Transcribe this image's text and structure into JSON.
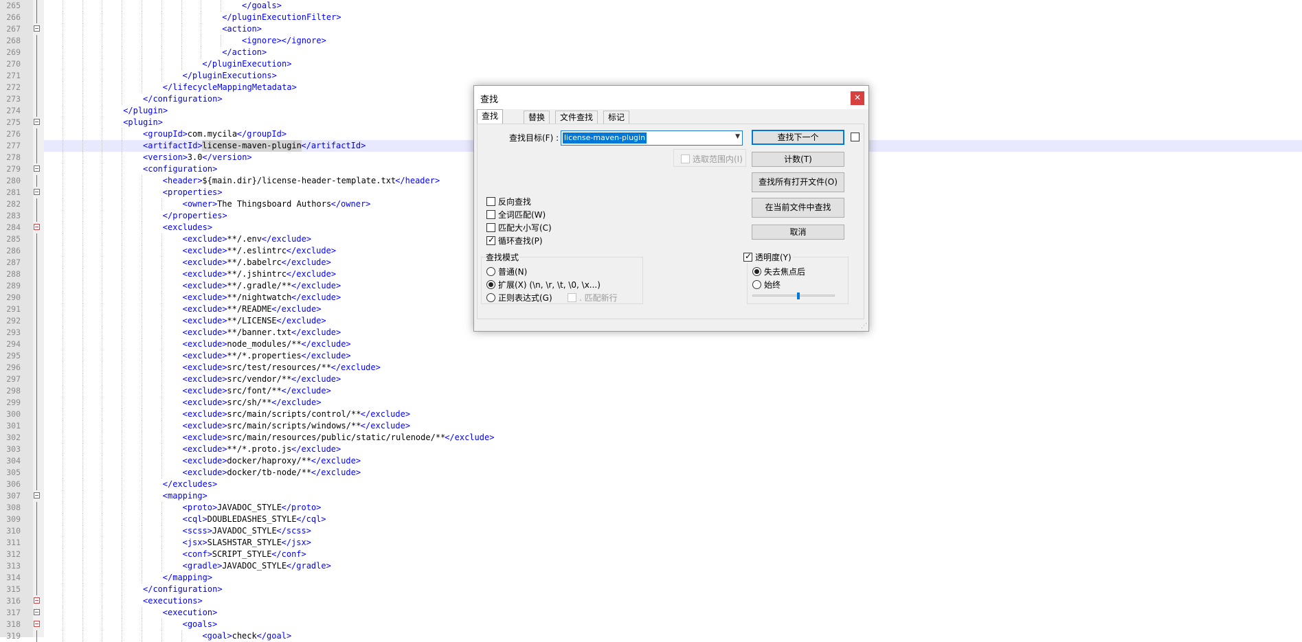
{
  "editor": {
    "first_line": 265,
    "current_line": 277,
    "lines": [
      {
        "n": "265",
        "level": 10,
        "parts": [
          {
            "t": "</goals>",
            "c": "tag"
          }
        ]
      },
      {
        "n": "266",
        "level": 9,
        "parts": [
          {
            "t": "</pluginExecutionFilter>",
            "c": "tag"
          }
        ]
      },
      {
        "n": "267",
        "level": 9,
        "fold": true,
        "parts": [
          {
            "t": "<action>",
            "c": "tag"
          }
        ]
      },
      {
        "n": "268",
        "level": 10,
        "parts": [
          {
            "t": "<ignore></ignore>",
            "c": "tag"
          }
        ]
      },
      {
        "n": "269",
        "level": 9,
        "parts": [
          {
            "t": "</action>",
            "c": "tag"
          }
        ]
      },
      {
        "n": "270",
        "level": 8,
        "parts": [
          {
            "t": "</pluginExecution>",
            "c": "tag"
          }
        ]
      },
      {
        "n": "271",
        "level": 7,
        "parts": [
          {
            "t": "</pluginExecutions>",
            "c": "tag"
          }
        ]
      },
      {
        "n": "272",
        "level": 6,
        "parts": [
          {
            "t": "</lifecycleMappingMetadata>",
            "c": "tag"
          }
        ]
      },
      {
        "n": "273",
        "level": 5,
        "parts": [
          {
            "t": "</configuration>",
            "c": "tag"
          }
        ]
      },
      {
        "n": "274",
        "level": 4,
        "parts": [
          {
            "t": "</plugin>",
            "c": "tag"
          }
        ]
      },
      {
        "n": "275",
        "level": 4,
        "fold": true,
        "parts": [
          {
            "t": "<plugin>",
            "c": "tag"
          }
        ]
      },
      {
        "n": "276",
        "level": 5,
        "parts": [
          {
            "t": "<groupId>",
            "c": "tag"
          },
          {
            "t": "com.mycila",
            "c": "text"
          },
          {
            "t": "</groupId>",
            "c": "tag"
          }
        ]
      },
      {
        "n": "277",
        "level": 5,
        "parts": [
          {
            "t": "<artifactId>",
            "c": "tag"
          },
          {
            "t": "license-maven-plugin",
            "c": "text",
            "hl": true
          },
          {
            "t": "</artifactId>",
            "c": "tag"
          }
        ]
      },
      {
        "n": "278",
        "level": 5,
        "parts": [
          {
            "t": "<version>",
            "c": "tag"
          },
          {
            "t": "3.0",
            "c": "text"
          },
          {
            "t": "</version>",
            "c": "tag"
          }
        ]
      },
      {
        "n": "279",
        "level": 5,
        "fold": true,
        "parts": [
          {
            "t": "<configuration>",
            "c": "tag"
          }
        ]
      },
      {
        "n": "280",
        "level": 6,
        "parts": [
          {
            "t": "<header>",
            "c": "tag"
          },
          {
            "t": "${main.dir}/license-header-template.txt",
            "c": "text"
          },
          {
            "t": "</header>",
            "c": "tag"
          }
        ]
      },
      {
        "n": "281",
        "level": 6,
        "fold": true,
        "parts": [
          {
            "t": "<properties>",
            "c": "tag"
          }
        ]
      },
      {
        "n": "282",
        "level": 7,
        "parts": [
          {
            "t": "<owner>",
            "c": "tag"
          },
          {
            "t": "The Thingsboard Authors",
            "c": "text"
          },
          {
            "t": "</owner>",
            "c": "tag"
          }
        ]
      },
      {
        "n": "283",
        "level": 6,
        "parts": [
          {
            "t": "</properties>",
            "c": "tag"
          }
        ]
      },
      {
        "n": "284",
        "level": 6,
        "fold": true,
        "parts": [
          {
            "t": "<excludes>",
            "c": "tag"
          }
        ]
      },
      {
        "n": "285",
        "level": 7,
        "parts": [
          {
            "t": "<exclude>",
            "c": "tag"
          },
          {
            "t": "**/.env",
            "c": "text"
          },
          {
            "t": "</exclude>",
            "c": "tag"
          }
        ]
      },
      {
        "n": "286",
        "level": 7,
        "parts": [
          {
            "t": "<exclude>",
            "c": "tag"
          },
          {
            "t": "**/.eslintrc",
            "c": "text"
          },
          {
            "t": "</exclude>",
            "c": "tag"
          }
        ]
      },
      {
        "n": "287",
        "level": 7,
        "parts": [
          {
            "t": "<exclude>",
            "c": "tag"
          },
          {
            "t": "**/.babelrc",
            "c": "text"
          },
          {
            "t": "</exclude>",
            "c": "tag"
          }
        ]
      },
      {
        "n": "288",
        "level": 7,
        "parts": [
          {
            "t": "<exclude>",
            "c": "tag"
          },
          {
            "t": "**/.jshintrc",
            "c": "text"
          },
          {
            "t": "</exclude>",
            "c": "tag"
          }
        ]
      },
      {
        "n": "289",
        "level": 7,
        "parts": [
          {
            "t": "<exclude>",
            "c": "tag"
          },
          {
            "t": "**/.gradle/**",
            "c": "text"
          },
          {
            "t": "</exclude>",
            "c": "tag"
          }
        ]
      },
      {
        "n": "290",
        "level": 7,
        "parts": [
          {
            "t": "<exclude>",
            "c": "tag"
          },
          {
            "t": "**/nightwatch",
            "c": "text"
          },
          {
            "t": "</exclude>",
            "c": "tag"
          }
        ]
      },
      {
        "n": "291",
        "level": 7,
        "parts": [
          {
            "t": "<exclude>",
            "c": "tag"
          },
          {
            "t": "**/README",
            "c": "text"
          },
          {
            "t": "</exclude>",
            "c": "tag"
          }
        ]
      },
      {
        "n": "292",
        "level": 7,
        "parts": [
          {
            "t": "<exclude>",
            "c": "tag"
          },
          {
            "t": "**/LICENSE",
            "c": "text"
          },
          {
            "t": "</exclude>",
            "c": "tag"
          }
        ]
      },
      {
        "n": "293",
        "level": 7,
        "parts": [
          {
            "t": "<exclude>",
            "c": "tag"
          },
          {
            "t": "**/banner.txt",
            "c": "text"
          },
          {
            "t": "</exclude>",
            "c": "tag"
          }
        ]
      },
      {
        "n": "294",
        "level": 7,
        "parts": [
          {
            "t": "<exclude>",
            "c": "tag"
          },
          {
            "t": "node_modules/**",
            "c": "text"
          },
          {
            "t": "</exclude>",
            "c": "tag"
          }
        ]
      },
      {
        "n": "295",
        "level": 7,
        "parts": [
          {
            "t": "<exclude>",
            "c": "tag"
          },
          {
            "t": "**/*.properties",
            "c": "text"
          },
          {
            "t": "</exclude>",
            "c": "tag"
          }
        ]
      },
      {
        "n": "296",
        "level": 7,
        "parts": [
          {
            "t": "<exclude>",
            "c": "tag"
          },
          {
            "t": "src/test/resources/**",
            "c": "text"
          },
          {
            "t": "</exclude>",
            "c": "tag"
          }
        ]
      },
      {
        "n": "297",
        "level": 7,
        "parts": [
          {
            "t": "<exclude>",
            "c": "tag"
          },
          {
            "t": "src/vendor/**",
            "c": "text"
          },
          {
            "t": "</exclude>",
            "c": "tag"
          }
        ]
      },
      {
        "n": "298",
        "level": 7,
        "parts": [
          {
            "t": "<exclude>",
            "c": "tag"
          },
          {
            "t": "src/font/**",
            "c": "text"
          },
          {
            "t": "</exclude>",
            "c": "tag"
          }
        ]
      },
      {
        "n": "299",
        "level": 7,
        "parts": [
          {
            "t": "<exclude>",
            "c": "tag"
          },
          {
            "t": "src/sh/**",
            "c": "text"
          },
          {
            "t": "</exclude>",
            "c": "tag"
          }
        ]
      },
      {
        "n": "300",
        "level": 7,
        "parts": [
          {
            "t": "<exclude>",
            "c": "tag"
          },
          {
            "t": "src/main/scripts/control/**",
            "c": "text"
          },
          {
            "t": "</exclude>",
            "c": "tag"
          }
        ]
      },
      {
        "n": "301",
        "level": 7,
        "parts": [
          {
            "t": "<exclude>",
            "c": "tag"
          },
          {
            "t": "src/main/scripts/windows/**",
            "c": "text"
          },
          {
            "t": "</exclude>",
            "c": "tag"
          }
        ]
      },
      {
        "n": "302",
        "level": 7,
        "parts": [
          {
            "t": "<exclude>",
            "c": "tag"
          },
          {
            "t": "src/main/resources/public/static/rulenode/**",
            "c": "text"
          },
          {
            "t": "</exclude>",
            "c": "tag"
          }
        ]
      },
      {
        "n": "303",
        "level": 7,
        "parts": [
          {
            "t": "<exclude>",
            "c": "tag"
          },
          {
            "t": "**/*.proto.js",
            "c": "text"
          },
          {
            "t": "</exclude>",
            "c": "tag"
          }
        ]
      },
      {
        "n": "304",
        "level": 7,
        "parts": [
          {
            "t": "<exclude>",
            "c": "tag"
          },
          {
            "t": "docker/haproxy/**",
            "c": "text"
          },
          {
            "t": "</exclude>",
            "c": "tag"
          }
        ]
      },
      {
        "n": "305",
        "level": 7,
        "parts": [
          {
            "t": "<exclude>",
            "c": "tag"
          },
          {
            "t": "docker/tb-node/**",
            "c": "text"
          },
          {
            "t": "</exclude>",
            "c": "tag"
          }
        ]
      },
      {
        "n": "306",
        "level": 6,
        "parts": [
          {
            "t": "</excludes>",
            "c": "tag"
          }
        ]
      },
      {
        "n": "307",
        "level": 6,
        "fold": true,
        "parts": [
          {
            "t": "<mapping>",
            "c": "tag"
          }
        ]
      },
      {
        "n": "308",
        "level": 7,
        "parts": [
          {
            "t": "<proto>",
            "c": "tag"
          },
          {
            "t": "JAVADOC_STYLE",
            "c": "text"
          },
          {
            "t": "</proto>",
            "c": "tag"
          }
        ]
      },
      {
        "n": "309",
        "level": 7,
        "parts": [
          {
            "t": "<cql>",
            "c": "tag"
          },
          {
            "t": "DOUBLEDASHES_STYLE",
            "c": "text"
          },
          {
            "t": "</cql>",
            "c": "tag"
          }
        ]
      },
      {
        "n": "310",
        "level": 7,
        "parts": [
          {
            "t": "<scss>",
            "c": "tag"
          },
          {
            "t": "JAVADOC_STYLE",
            "c": "text"
          },
          {
            "t": "</scss>",
            "c": "tag"
          }
        ]
      },
      {
        "n": "311",
        "level": 7,
        "parts": [
          {
            "t": "<jsx>",
            "c": "tag"
          },
          {
            "t": "SLASHSTAR_STYLE",
            "c": "text"
          },
          {
            "t": "</jsx>",
            "c": "tag"
          }
        ]
      },
      {
        "n": "312",
        "level": 7,
        "parts": [
          {
            "t": "<conf>",
            "c": "tag"
          },
          {
            "t": "SCRIPT_STYLE",
            "c": "text"
          },
          {
            "t": "</conf>",
            "c": "tag"
          }
        ]
      },
      {
        "n": "313",
        "level": 7,
        "parts": [
          {
            "t": "<gradle>",
            "c": "tag"
          },
          {
            "t": "JAVADOC_STYLE",
            "c": "text"
          },
          {
            "t": "</gradle>",
            "c": "tag"
          }
        ]
      },
      {
        "n": "314",
        "level": 6,
        "parts": [
          {
            "t": "</mapping>",
            "c": "tag"
          }
        ]
      },
      {
        "n": "315",
        "level": 5,
        "parts": [
          {
            "t": "</configuration>",
            "c": "tag"
          }
        ]
      },
      {
        "n": "316",
        "level": 5,
        "fold": true,
        "parts": [
          {
            "t": "<executions>",
            "c": "tag"
          }
        ]
      },
      {
        "n": "317",
        "level": 6,
        "fold": true,
        "parts": [
          {
            "t": "<execution>",
            "c": "tag"
          }
        ]
      },
      {
        "n": "318",
        "level": 7,
        "fold": true,
        "parts": [
          {
            "t": "<goals>",
            "c": "tag"
          }
        ]
      },
      {
        "n": "319",
        "level": 8,
        "parts": [
          {
            "t": "<goal>",
            "c": "tag"
          },
          {
            "t": "check",
            "c": "text"
          },
          {
            "t": "</goal>",
            "c": "tag"
          }
        ]
      }
    ]
  },
  "dialog": {
    "title": "查找",
    "close_glyph": "✕",
    "tabs": [
      {
        "label": "查找",
        "active": true
      },
      {
        "label": "替换",
        "active": false
      },
      {
        "label": "文件查找",
        "active": false
      },
      {
        "label": "标记",
        "active": false
      }
    ],
    "find_label": "查找目标(F) :",
    "find_value": "license-maven-plugin",
    "dropdown_glyph": "▼",
    "in_selection_label": "选取范围内(I)",
    "buttons": {
      "find_next": "查找下一个",
      "count": "计数(T)",
      "find_all_open": "查找所有打开文件(O)",
      "find_in_current": "在当前文件中查找",
      "cancel": "取消"
    },
    "options": [
      {
        "label": "反向查找",
        "checked": false
      },
      {
        "label": "全词匹配(W)",
        "checked": false
      },
      {
        "label": "匹配大小写(C)",
        "checked": false
      },
      {
        "label": "循环查找(P)",
        "checked": true
      }
    ],
    "search_mode": {
      "title": "查找模式",
      "normal": "普通(N)",
      "extended": "扩展(X) (\\n, \\r, \\t, \\0, \\x...)",
      "regex": "正则表达式(G)",
      "dot_newline": ". 匹配新行",
      "selected": "extended"
    },
    "transparency": {
      "title": "透明度(Y)",
      "checked": true,
      "on_losing_focus": "失去焦点后",
      "always": "始终",
      "selected": "on_losing_focus",
      "level": 0.55
    },
    "grip_glyph": "⋰"
  }
}
